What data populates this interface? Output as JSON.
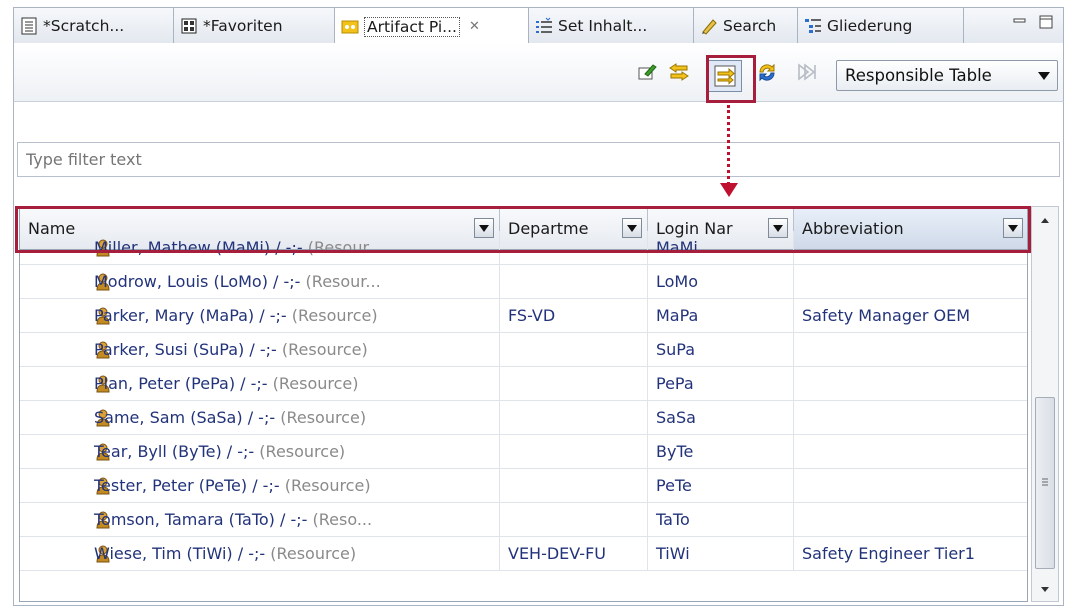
{
  "tabs": [
    {
      "label": "*Scratch...",
      "icon": "scratch-doc-icon"
    },
    {
      "label": "*Favoriten",
      "icon": "favorites-grid-icon"
    },
    {
      "label": "Artifact Pi...",
      "icon": "artifact-picker-icon",
      "active": true
    },
    {
      "label": "Set Inhalt...",
      "icon": "set-content-icon"
    },
    {
      "label": "Search",
      "icon": "search-pencil-icon"
    },
    {
      "label": "Gliederung",
      "icon": "outline-icon"
    }
  ],
  "toolbar": {
    "combo_value": "Responsible Table",
    "icons": [
      "edit-artifact-icon",
      "sync-left-icon",
      "link-with-editor-icon",
      "refresh-icon",
      "step-forward-icon"
    ]
  },
  "filter": {
    "placeholder": "Type filter text"
  },
  "table": {
    "columns": [
      "Name",
      "Departme",
      "Login Nar",
      "Abbreviation"
    ],
    "rows": [
      {
        "name": "Miller, Mathew (MaMi) / -;-",
        "type": "(Resour...",
        "department": "",
        "login": "MaMi",
        "abbreviation": ""
      },
      {
        "name": "Modrow, Louis (LoMo) / -;-",
        "type": "(Resour...",
        "department": "",
        "login": "LoMo",
        "abbreviation": ""
      },
      {
        "name": "Parker, Mary (MaPa) / -;-",
        "type": "(Resource)",
        "department": "FS-VD",
        "login": "MaPa",
        "abbreviation": "Safety Manager OEM"
      },
      {
        "name": "Parker, Susi (SuPa) / -;-",
        "type": "(Resource)",
        "department": "",
        "login": "SuPa",
        "abbreviation": ""
      },
      {
        "name": "Plan, Peter (PePa) / -;-",
        "type": "(Resource)",
        "department": "",
        "login": "PePa",
        "abbreviation": ""
      },
      {
        "name": "Same, Sam (SaSa) / -;-",
        "type": "(Resource)",
        "department": "",
        "login": "SaSa",
        "abbreviation": ""
      },
      {
        "name": "Tear, Byll (ByTe) / -;-",
        "type": "(Resource)",
        "department": "",
        "login": "ByTe",
        "abbreviation": ""
      },
      {
        "name": "Tester, Peter (PeTe) / -;-",
        "type": "(Resource)",
        "department": "",
        "login": "PeTe",
        "abbreviation": ""
      },
      {
        "name": "Tomson, Tamara (TaTo) / -;-",
        "type": "(Reso...",
        "department": "",
        "login": "TaTo",
        "abbreviation": ""
      },
      {
        "name": "Wiese, Tim (TiWi) / -;-",
        "type": "(Resource)",
        "department": "VEH-DEV-FU",
        "login": "TiWi",
        "abbreviation": "Safety Engineer Tier1"
      }
    ]
  },
  "colors": {
    "annotation": "#a61e3c",
    "link_text": "#22337a",
    "muted_text": "#8a8a8a"
  }
}
